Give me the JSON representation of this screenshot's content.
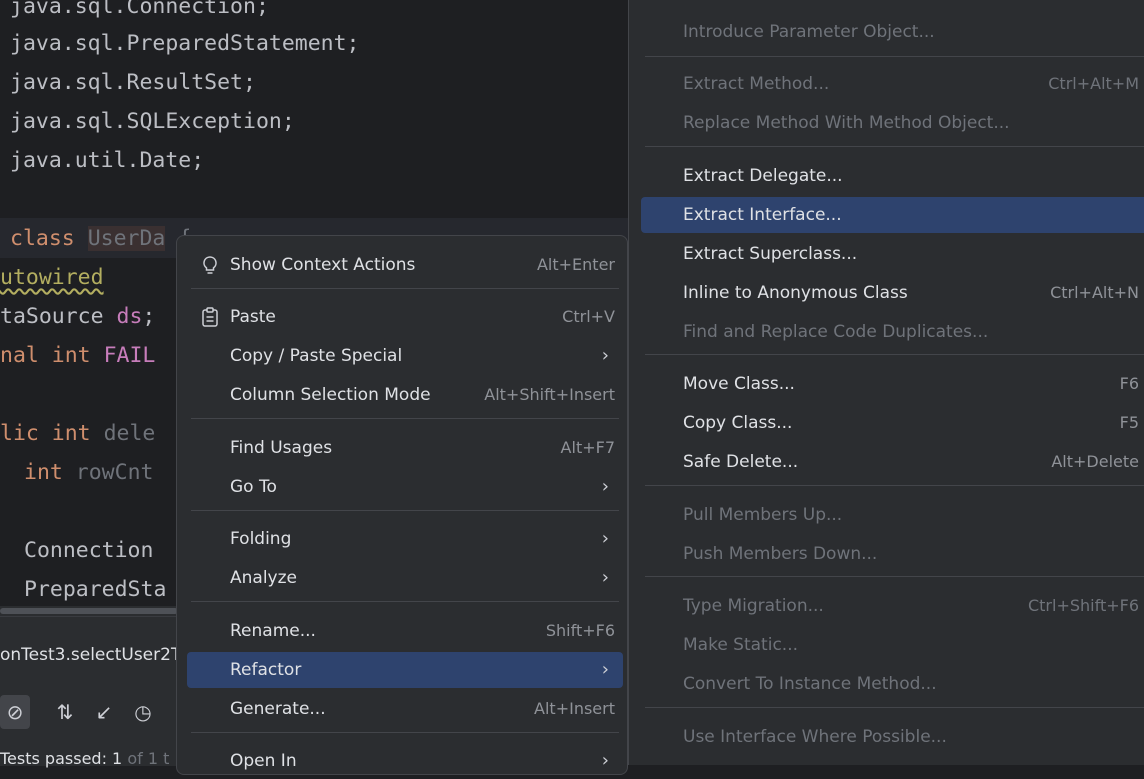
{
  "editor": {
    "lines": [
      "java.sql.Connection;",
      "java.sql.PreparedStatement;",
      "java.sql.ResultSet;",
      "java.sql.SQLException;",
      "java.util.Date;"
    ],
    "class_kw": "class",
    "class_name": "UserDa",
    "class_brace": "{",
    "autowired": "utowired",
    "ds_type": "taSource",
    "ds_name": "ds",
    "ds_end": ";",
    "final_kw": "nal int",
    "final_name": "FAIL",
    "method_kw": "lic int",
    "method_name": "dele",
    "rowcnt_kw": "int",
    "rowcnt_name": "rowCnt",
    "conn": "Connection",
    "pstmt": "PreparedSta"
  },
  "run_panel": {
    "title": "onTest3.selectUser2Te",
    "status_prefix": "Tests passed:",
    "status_count": "1",
    "status_rest": "of 1 t"
  },
  "context_menu": {
    "items": [
      {
        "label": "Show Context Actions",
        "shortcut": "Alt+Enter"
      },
      {
        "label": "Paste",
        "shortcut": "Ctrl+V"
      },
      {
        "label": "Copy / Paste Special",
        "shortcut": "›"
      },
      {
        "label": "Column Selection Mode",
        "shortcut": "Alt+Shift+Insert"
      },
      {
        "label": "Find Usages",
        "shortcut": "Alt+F7"
      },
      {
        "label": "Go To",
        "shortcut": "›"
      },
      {
        "label": "Folding",
        "shortcut": "›"
      },
      {
        "label": "Analyze",
        "shortcut": "›"
      },
      {
        "label": "Rename...",
        "shortcut": "Shift+F6"
      },
      {
        "label": "Refactor",
        "shortcut": "›"
      },
      {
        "label": "Generate...",
        "shortcut": "Alt+Insert"
      },
      {
        "label": "Open In",
        "shortcut": "›"
      }
    ]
  },
  "refactor_submenu": {
    "items": [
      {
        "label": "Introduce Parameter Object...",
        "shortcut": ""
      },
      {
        "label": "Extract Method...",
        "shortcut": "Ctrl+Alt+M"
      },
      {
        "label": "Replace Method With Method Object...",
        "shortcut": ""
      },
      {
        "label": "Extract Delegate...",
        "shortcut": ""
      },
      {
        "label": "Extract Interface...",
        "shortcut": ""
      },
      {
        "label": "Extract Superclass...",
        "shortcut": ""
      },
      {
        "label": "Inline to Anonymous Class",
        "shortcut": "Ctrl+Alt+N"
      },
      {
        "label": "Find and Replace Code Duplicates...",
        "shortcut": ""
      },
      {
        "label": "Move Class...",
        "shortcut": "F6"
      },
      {
        "label": "Copy Class...",
        "shortcut": "F5"
      },
      {
        "label": "Safe Delete...",
        "shortcut": "Alt+Delete"
      },
      {
        "label": "Pull Members Up...",
        "shortcut": ""
      },
      {
        "label": "Push Members Down...",
        "shortcut": ""
      },
      {
        "label": "Type Migration...",
        "shortcut": "Ctrl+Shift+F6"
      },
      {
        "label": "Make Static...",
        "shortcut": ""
      },
      {
        "label": "Convert To Instance Method...",
        "shortcut": ""
      },
      {
        "label": "Use Interface Where Possible...",
        "shortcut": ""
      }
    ]
  },
  "colors": {
    "menu_bg": "#2b2d30",
    "selection": "#2e436e",
    "text": "#dfe1e5",
    "disabled_text": "#6f737a"
  }
}
